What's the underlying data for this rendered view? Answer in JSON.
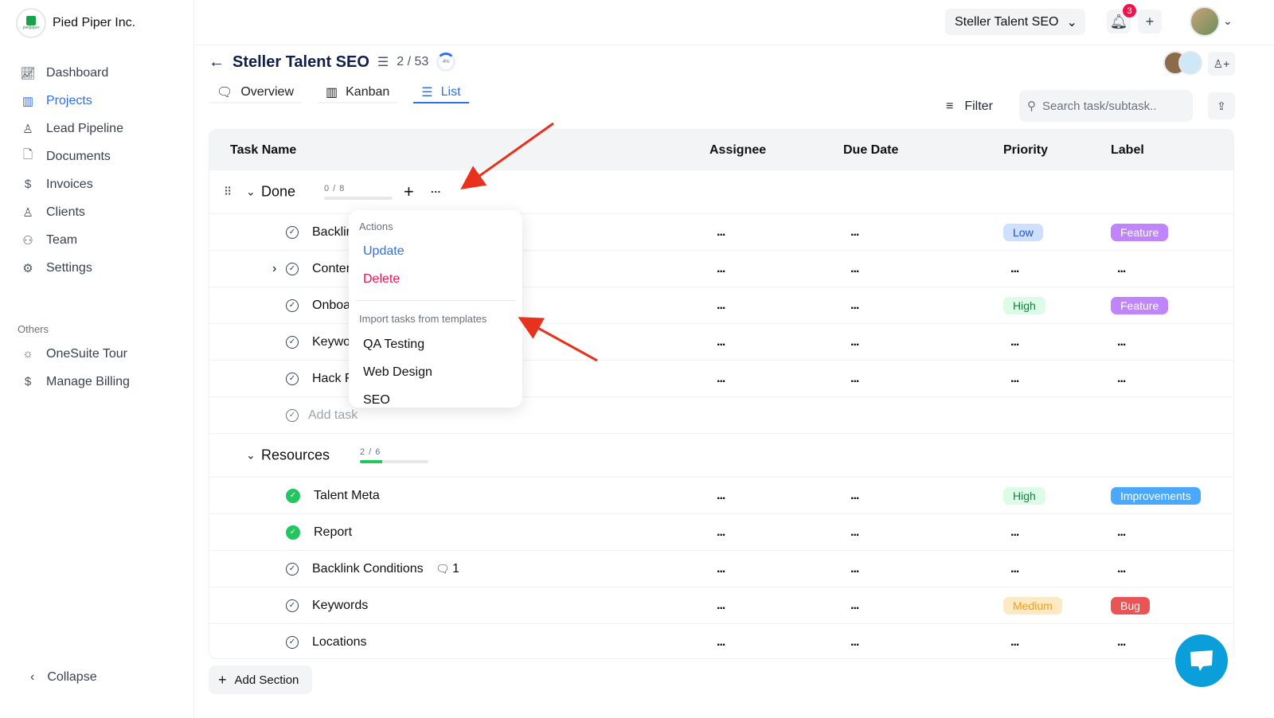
{
  "brand": {
    "name": "Pied Piper Inc.",
    "logo_text": "piedpiper"
  },
  "sidebar": {
    "items": [
      {
        "label": "Dashboard",
        "icon": "chart-line-icon"
      },
      {
        "label": "Projects",
        "icon": "kanban-icon",
        "active": true
      },
      {
        "label": "Lead Pipeline",
        "icon": "user-search-icon"
      },
      {
        "label": "Documents",
        "icon": "document-icon"
      },
      {
        "label": "Invoices",
        "icon": "invoice-icon"
      },
      {
        "label": "Clients",
        "icon": "user-icon"
      },
      {
        "label": "Team",
        "icon": "users-icon"
      },
      {
        "label": "Settings",
        "icon": "gear-icon"
      }
    ],
    "others_label": "Others",
    "others": [
      {
        "label": "OneSuite Tour",
        "icon": "sun-icon"
      },
      {
        "label": "Manage Billing",
        "icon": "dollar-icon"
      }
    ],
    "collapse": "Collapse"
  },
  "topbar": {
    "project": "Steller Talent SEO",
    "notifications": "3"
  },
  "project": {
    "title": "Steller Talent SEO",
    "task_count": "2 / 53",
    "progress": "4%"
  },
  "tabs": [
    "Overview",
    "Kanban",
    "List"
  ],
  "toolbar": {
    "filter": "Filter",
    "search_placeholder": "Search task/subtask.."
  },
  "table": {
    "headers": [
      "Task Name",
      "Assignee",
      "Due Date",
      "Priority",
      "Label"
    ],
    "sections": [
      {
        "name": "Done",
        "count": "0 / 8",
        "progress": 0,
        "tasks": [
          {
            "name": "Backlir",
            "priority": "Low",
            "label": "Feature"
          },
          {
            "name": "Conter",
            "priority": "",
            "label": "",
            "expandable": true
          },
          {
            "name": "Onboa",
            "priority": "High",
            "label": "Feature"
          },
          {
            "name": "Keywo",
            "priority": "",
            "label": ""
          },
          {
            "name": "Hack F",
            "priority": "",
            "label": ""
          }
        ],
        "add_task": "Add task"
      },
      {
        "name": "Resources",
        "count": "2 / 6",
        "progress": 0.33,
        "tasks": [
          {
            "name": "Talent Meta",
            "done": true,
            "priority": "High",
            "label": "Improvements"
          },
          {
            "name": "Report",
            "done": true,
            "priority": "",
            "label": ""
          },
          {
            "name": "Backlink Conditions",
            "comments": "1",
            "priority": "",
            "label": ""
          },
          {
            "name": "Keywords",
            "priority": "Medium",
            "label": "Bug"
          },
          {
            "name": "Locations",
            "priority": "",
            "label": ""
          }
        ]
      }
    ],
    "placeholder": "..."
  },
  "menu": {
    "actions_header": "Actions",
    "update": "Update",
    "delete": "Delete",
    "import_header": "Import tasks from templates",
    "templates": [
      "QA Testing",
      "Web Design",
      "SEO"
    ]
  },
  "add_section": "Add Section",
  "colors": {
    "accent": "#2f6fed",
    "delete": "#f0134d",
    "low_bg": "#cfe0ff",
    "high_bg": "#dcfce7",
    "medium_bg": "#fde9c4",
    "feature": "#c084fc",
    "improvements": "#4aa8ff",
    "bug": "#ea5455",
    "arrow": "#e8321e"
  }
}
